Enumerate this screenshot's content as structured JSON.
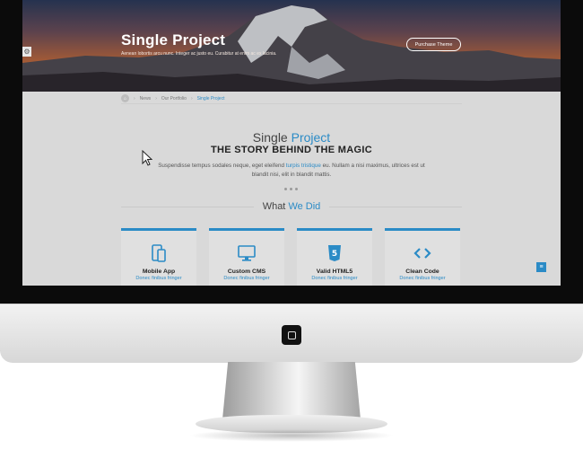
{
  "hero": {
    "title": "Single Project",
    "subtitle": "Aenean lobortis arcu nunc. Integer ac justo eu. Curabitur at enim ac ex lacinia.",
    "button_label": "Purchase Theme"
  },
  "breadcrumb": {
    "items": [
      "News",
      "Our Portfolio",
      "Single Project"
    ]
  },
  "project": {
    "title_plain": "Single",
    "title_accent": "Project",
    "tagline": "THE STORY BEHIND THE MAGIC",
    "lead_1": "Suspendisse tempus sodales neque, eget eleifend",
    "lead_link": "turpis tristique",
    "lead_2": "eu. Nullam a nisi maximus, ultrices est ut blandit nisi, elit in blandit mattis."
  },
  "what_we_did": {
    "title_plain": "What",
    "title_accent": "We Did",
    "cards": [
      {
        "title": "Mobile App",
        "sub": "Donec finibus fringer",
        "icon": "mobile-icon"
      },
      {
        "title": "Custom CMS",
        "sub": "Donec finibus fringer",
        "icon": "monitor-icon"
      },
      {
        "title": "Valid HTML5",
        "sub": "Donec finibus fringer",
        "icon": "html5-icon"
      },
      {
        "title": "Clean Code",
        "sub": "Donec finibus fringer",
        "icon": "code-icon"
      }
    ]
  },
  "colors": {
    "accent": "#2b8bc6",
    "screen_bg": "#d9d9d9"
  }
}
